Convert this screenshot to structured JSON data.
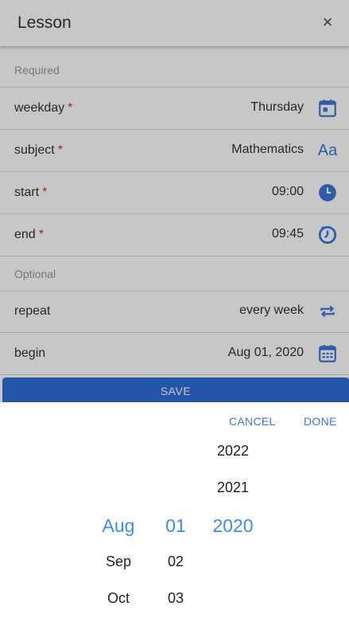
{
  "header": {
    "title": "Lesson",
    "close_label": "×"
  },
  "sections": {
    "required": "Required",
    "optional": "Optional"
  },
  "required_marker": "*",
  "fields": {
    "weekday": {
      "label": "weekday",
      "value": "Thursday",
      "icon": "calendar-icon"
    },
    "subject": {
      "label": "subject",
      "value": "Mathematics",
      "icon": "text-format-icon",
      "icon_text": "Aa"
    },
    "start": {
      "label": "start",
      "value": "09:00",
      "icon": "clock-icon"
    },
    "end": {
      "label": "end",
      "value": "09:45",
      "icon": "timer-icon"
    },
    "repeat": {
      "label": "repeat",
      "value": "every week",
      "icon": "repeat-icon"
    },
    "begin": {
      "label": "begin",
      "value": "Aug 01, 2020",
      "icon": "calendar-grid-icon"
    }
  },
  "save_label": "SAVE",
  "picker": {
    "cancel_label": "CANCEL",
    "done_label": "DONE",
    "months": [
      "Aug",
      "Sep",
      "Oct"
    ],
    "days": [
      "01",
      "02",
      "03"
    ],
    "years": [
      "2022",
      "2021",
      "2020"
    ],
    "selected": {
      "month": "Aug",
      "day": "01",
      "year": "2020"
    }
  },
  "colors": {
    "accent": "#3b78d9",
    "selected": "#3b8de8",
    "required": "#d32f2f",
    "save_bg": "#2e6fd8"
  }
}
